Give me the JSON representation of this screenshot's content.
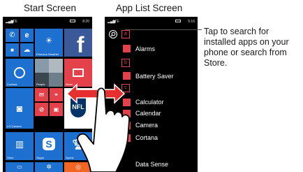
{
  "captions": {
    "start": "Start Screen",
    "list": "App List Screen"
  },
  "status_start": {
    "net": "LTE",
    "time": "8:20"
  },
  "status_list": {
    "net": "LTE",
    "time": "5:16"
  },
  "tiles": {
    "people_label": "People",
    "cortana_label": "Cortana",
    "news_label": "News",
    "camera_label": "LG Camera",
    "store_label": "Store",
    "skype_label": "Skype",
    "sports_label": "Sports",
    "weather_label": "Emerson Weather",
    "nfl_text": "NFL"
  },
  "app_list": {
    "letters": [
      "a",
      "b",
      "c"
    ],
    "apps": [
      "Alarms",
      "Battery Saver",
      "Calculator",
      "Calendar",
      "Camera",
      "Cortana",
      "Data Sense"
    ]
  },
  "callout": {
    "text": "Tap to search for installed apps on your phone or search from Store."
  },
  "colors": {
    "tile_blue": "#1d6fd0",
    "accent_red": "#e5414a",
    "facebook_blue": "#3b5998",
    "arrow_red": "#e63030"
  }
}
